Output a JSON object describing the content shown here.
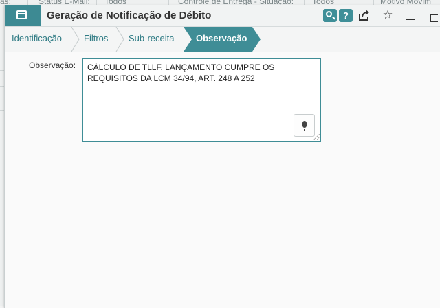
{
  "background": {
    "columns": [
      {
        "label": "as:"
      },
      {
        "label": "Status E-Mail:"
      },
      {
        "label": "Todos"
      },
      {
        "label": "Controle de Entrega - Situação:"
      },
      {
        "label": "Todos"
      },
      {
        "label": "Motivo Movim"
      }
    ]
  },
  "modal": {
    "title": "Geração de Notificação de Débito",
    "toolbar": {
      "help_label": "?"
    },
    "steps": [
      {
        "label": "Identificação"
      },
      {
        "label": "Filtros"
      },
      {
        "label": "Sub-receita"
      },
      {
        "label": "Observação",
        "active": true
      }
    ],
    "form": {
      "observacao_label": "Observação:",
      "observacao_value": "CÁLCULO DE TLLF. LANÇAMENTO CUMPRE OS\nREQUISITOS DA LCM 34/94, ART. 248 A 252"
    }
  },
  "colors": {
    "accent": "#3f8d96",
    "link": "#2f7b84"
  },
  "icons": [
    "app-window-icon",
    "search-icon",
    "help-icon",
    "share-icon",
    "star-icon",
    "minimize-icon",
    "microphone-icon"
  ]
}
